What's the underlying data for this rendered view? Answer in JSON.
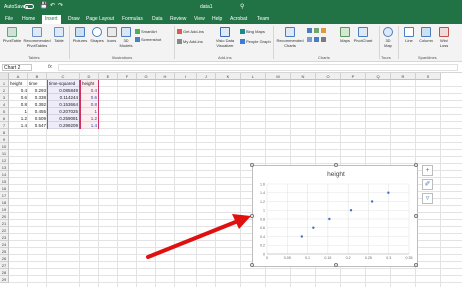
{
  "window": {
    "autosave_label": "AutoSave",
    "autosave_state": "Off",
    "doc_title": "data1",
    "undo_icon": "undo-icon",
    "redo_icon": "redo-icon",
    "save_icon": "save-icon"
  },
  "tabs": [
    {
      "label": "File"
    },
    {
      "label": "Home"
    },
    {
      "label": "Insert",
      "active": true
    },
    {
      "label": "Draw"
    },
    {
      "label": "Page Layout"
    },
    {
      "label": "Formulas"
    },
    {
      "label": "Data"
    },
    {
      "label": "Review"
    },
    {
      "label": "View"
    },
    {
      "label": "Help"
    },
    {
      "label": "Acrobat"
    },
    {
      "label": "Team"
    }
  ],
  "ribbon": {
    "tables": {
      "pivot": "PivotTable",
      "recommended_pivot_line1": "Recommended",
      "recommended_pivot_line2": "PivotTables",
      "table": "Table",
      "group": "Tables"
    },
    "illustrations": {
      "pictures": "Pictures",
      "shapes": "Shapes",
      "icons": "Icons",
      "models_line1": "3D",
      "models_line2": "Models",
      "smartart": "SmartArt",
      "screenshot": "Screenshot",
      "group": "Illustrations"
    },
    "addins": {
      "get": "Get Add-ins",
      "my": "My Add-ins",
      "visio_line1": "Visio Data",
      "visio_line2": "Visualizer",
      "bing": "Bing Maps",
      "people": "People Graph",
      "group": "Add-ins"
    },
    "charts": {
      "recommended_line1": "Recommended",
      "recommended_line2": "Charts",
      "maps": "Maps",
      "pivotchart": "PivotChart",
      "group": "Charts"
    },
    "tours": {
      "map_line1": "3D",
      "map_line2": "Map",
      "group": "Tours"
    },
    "sparklines": {
      "line": "Line",
      "column": "Column",
      "winloss_line1": "Win/",
      "winloss_line2": "Loss",
      "group": "Sparklines"
    }
  },
  "formula_bar": {
    "name_box": "Chart 2",
    "fx": "fx",
    "value": ""
  },
  "columns": [
    "A",
    "B",
    "C",
    "D",
    "E",
    "F",
    "G",
    "H",
    "I",
    "J",
    "K",
    "L",
    "M",
    "N",
    "O",
    "P",
    "Q",
    "R",
    "S",
    "T"
  ],
  "rows": [
    "1",
    "2",
    "3",
    "4",
    "5",
    "6",
    "7",
    "8",
    "9",
    "10",
    "11",
    "12",
    "13",
    "14",
    "15",
    "16",
    "17",
    "18",
    "19",
    "20",
    "21",
    "22",
    "23",
    "24",
    "25",
    "26",
    "27",
    "28",
    "29",
    "30"
  ],
  "cells": {
    "headers": {
      "A": "height",
      "B": "time",
      "C": "time-squared",
      "D": "height"
    },
    "data": [
      {
        "A": "0.4",
        "B": "0.293",
        "C": "0.085849",
        "D": "0.4"
      },
      {
        "A": "0.6",
        "B": "0.338",
        "C": "0.114244",
        "D": "0.6"
      },
      {
        "A": "0.8",
        "B": "0.392",
        "C": "0.153664",
        "D": "0.8"
      },
      {
        "A": "1",
        "B": "0.455",
        "C": "0.207025",
        "D": "1"
      },
      {
        "A": "1.2",
        "B": "0.509",
        "C": "0.259081",
        "D": "1.2"
      },
      {
        "A": "1.4",
        "B": "0.547",
        "C": "0.299209",
        "D": "1.4"
      }
    ]
  },
  "chart_data": {
    "type": "scatter",
    "title": "height",
    "x": [
      0.085849,
      0.114244,
      0.153664,
      0.207025,
      0.259081,
      0.299209
    ],
    "y": [
      0.4,
      0.6,
      0.8,
      1,
      1.2,
      1.4
    ],
    "xlim": [
      0,
      0.35
    ],
    "ylim": [
      0,
      1.6
    ],
    "xticks": [
      "0",
      "0.05",
      "0.1",
      "0.15",
      "0.2",
      "0.25",
      "0.3",
      "0.35"
    ],
    "yticks": [
      "0",
      "0.2",
      "0.4",
      "0.6",
      "0.8",
      "1",
      "1.2",
      "1.4",
      "1.6"
    ],
    "grid": true,
    "legend": "none",
    "point_color": "#4472c4"
  },
  "chart_tools": {
    "add_element_icon": "plus-icon",
    "styles_icon": "brush-icon",
    "filter_icon": "filter-icon"
  },
  "colors": {
    "accent": "#217346",
    "annotation_arrow": "#e01010"
  }
}
